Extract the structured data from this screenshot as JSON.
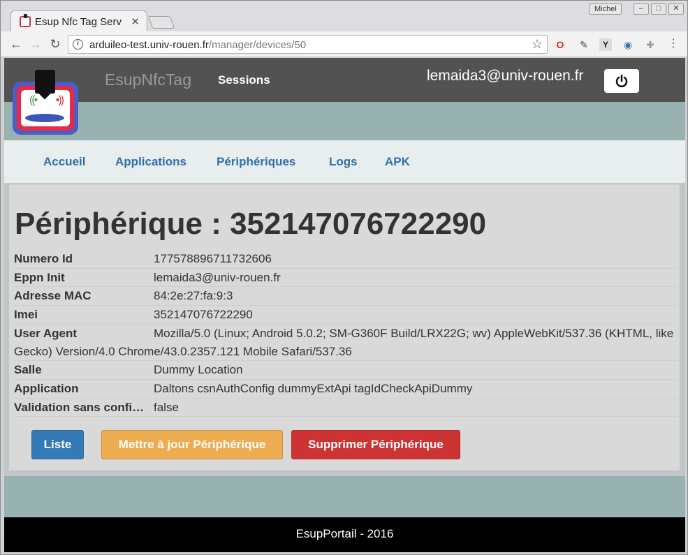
{
  "browser": {
    "tab_title": "Esup Nfc Tag Serv",
    "profile": "Michel",
    "url_host": "arduileo-test.univ-rouen.fr",
    "url_path": "/manager/devices/50"
  },
  "header": {
    "brand": "EsupNfcTag",
    "sessions": "Sessions",
    "user": "lemaida3@univ-rouen.fr"
  },
  "nav": {
    "items": [
      "Accueil",
      "Applications",
      "Périphériques",
      "Logs",
      "APK"
    ]
  },
  "main": {
    "title": "Périphérique : 352147076722290",
    "fields": [
      {
        "label": "Numero Id",
        "value": "177578896711732606"
      },
      {
        "label": "Eppn Init",
        "value": "lemaida3@univ-rouen.fr"
      },
      {
        "label": "Adresse MAC",
        "value": "84:2e:27:fa:9:3"
      },
      {
        "label": "Imei",
        "value": "352147076722290"
      },
      {
        "label": "User Agent",
        "value": "Mozilla/5.0 (Linux; Android 5.0.2; SM-G360F Build/LRX22G; wv) AppleWebKit/537.36 (KHTML, like Gecko) Version/4.0 Chrome/43.0.2357.121 Mobile Safari/537.36"
      },
      {
        "label": "Salle",
        "value": "Dummy Location"
      },
      {
        "label": "Application",
        "value": "Daltons csnAuthConfig dummyExtApi tagIdCheckApiDummy"
      },
      {
        "label": "Validation sans confi…",
        "value": "false"
      }
    ],
    "buttons": {
      "list": "Liste",
      "update": "Mettre à jour Périphérique",
      "delete": "Supprimer Périphérique"
    }
  },
  "footer": {
    "text": "EsupPortail - 2016"
  }
}
